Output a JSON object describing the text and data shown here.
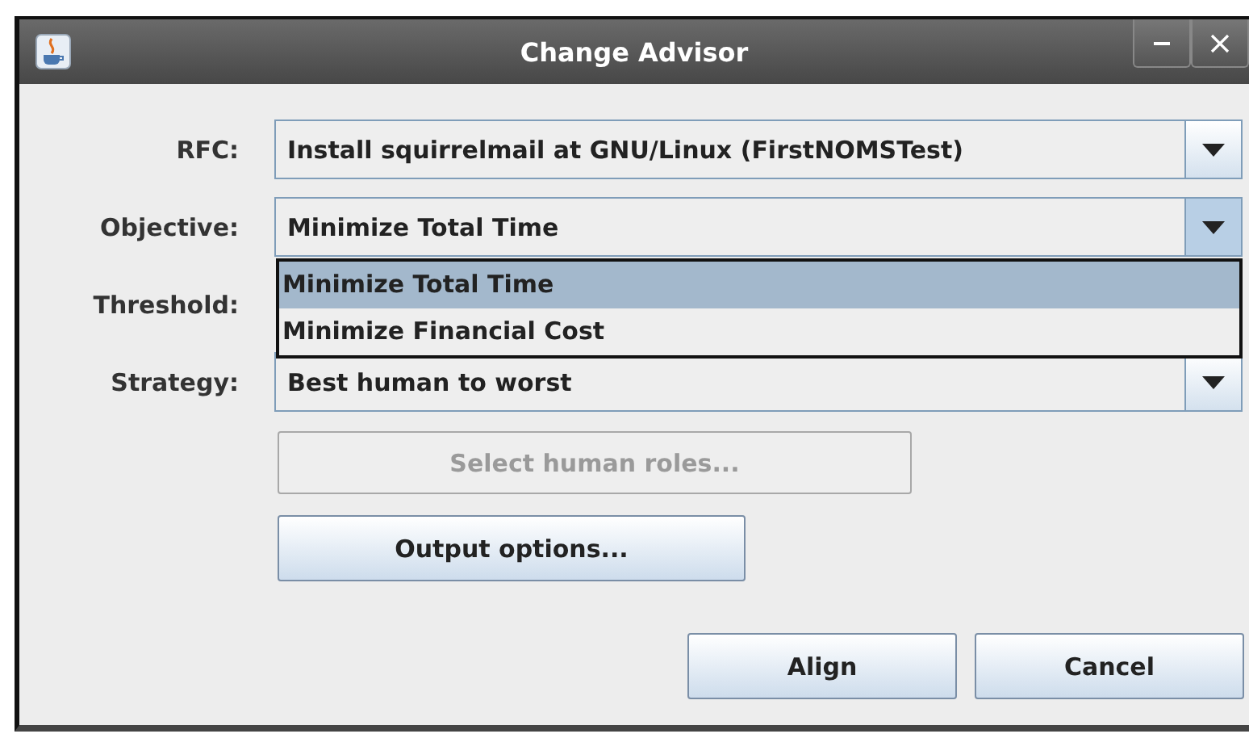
{
  "window": {
    "title": "Change Advisor"
  },
  "fields": [
    {
      "label": "RFC:",
      "kind": "combo",
      "value": "Install squirrelmail at GNU/Linux (FirstNOMSTest)",
      "expanded": false
    },
    {
      "label": "Objective:",
      "kind": "combo",
      "value": "Minimize Total Time",
      "expanded": true,
      "options": [
        {
          "label": "Minimize Total Time",
          "selected": true
        },
        {
          "label": "Minimize Financial Cost",
          "selected": false
        }
      ]
    },
    {
      "label": "Threshold:",
      "kind": "hidden"
    },
    {
      "label": "Strategy:",
      "kind": "combo",
      "value": "Best human to worst",
      "expanded": false
    }
  ],
  "option_buttons": [
    {
      "label": "Select human roles...",
      "disabled": true
    },
    {
      "label": "Output options...",
      "disabled": false
    }
  ],
  "dialog_buttons": [
    {
      "label": "Align",
      "disabled": false
    },
    {
      "label": "Cancel",
      "disabled": false
    }
  ]
}
